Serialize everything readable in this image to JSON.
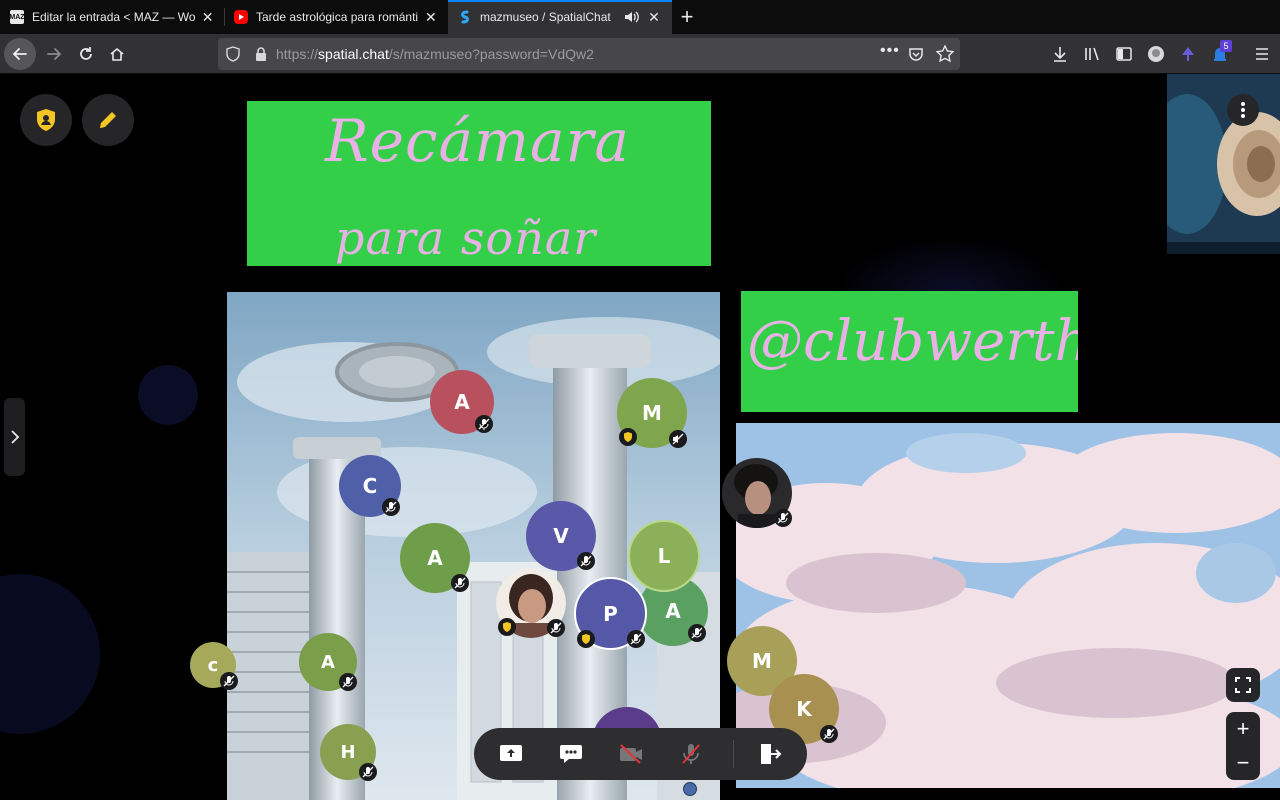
{
  "browser": {
    "tabs": [
      {
        "title": "Editar la entrada < MAZ — WordPress",
        "favicon": "maz-favicon",
        "favicon_text": "MAZ",
        "active": false
      },
      {
        "title": "Tarde astrológica para románticos",
        "favicon": "youtube-favicon",
        "active": false
      },
      {
        "title": "mazmuseo / SpatialChat",
        "favicon": "spatialchat-favicon",
        "active": true,
        "audio": true
      }
    ],
    "url_prefix": "https://",
    "url_host": "spatial.chat",
    "url_rest": "/s/mazmuseo?password=VdQw2",
    "extension_badge": "5",
    "accent": "#0a84ff"
  },
  "room": {
    "signs": [
      {
        "lines": [
          "Recámara",
          "para soñar"
        ],
        "bg": "#33cf48",
        "text_color": "#eab1e6"
      },
      {
        "lines": [
          "@clubwerther"
        ],
        "bg": "#33cf48",
        "text_color": "#eab1e6"
      }
    ],
    "media": [
      "greek-columns-room-image",
      "clouds-sky-image",
      "nautilus-shell-image"
    ],
    "participants": [
      {
        "initial": "A",
        "color": "#b8505e",
        "muted": true
      },
      {
        "initial": "M",
        "color": "#7fa64c",
        "muted": true,
        "host": true,
        "speaker_muted": true
      },
      {
        "initial": "C",
        "color": "#5060a8",
        "muted": true
      },
      {
        "initial": "V",
        "color": "#5a58a8",
        "muted": true
      },
      {
        "initial": "A",
        "color": "#6e9e4a",
        "muted": true
      },
      {
        "initial": "L",
        "color": "#8cb05a",
        "muted": false
      },
      {
        "initial": "",
        "color": "#b07a60",
        "muted": true,
        "host": true,
        "video": true
      },
      {
        "initial": "P",
        "color": "#5558a6",
        "muted": true,
        "host": true,
        "self": true
      },
      {
        "initial": "A",
        "color": "#5aa060",
        "muted": true
      },
      {
        "initial": "c",
        "color": "#a6a85a",
        "muted": true
      },
      {
        "initial": "A",
        "color": "#7a9e4a",
        "muted": true
      },
      {
        "initial": "H",
        "color": "#88a050",
        "muted": true
      },
      {
        "initial": "",
        "color": "#3b3340",
        "muted": true,
        "video": true
      },
      {
        "initial": "M",
        "color": "#a8a058",
        "muted": false
      },
      {
        "initial": "K",
        "color": "#a89050",
        "muted": true
      }
    ]
  },
  "toolbar": {
    "items": [
      "share-screen",
      "chat",
      "camera-off",
      "microphone-muted",
      "leave-room"
    ],
    "zoom_in": "+",
    "zoom_out": "−"
  }
}
